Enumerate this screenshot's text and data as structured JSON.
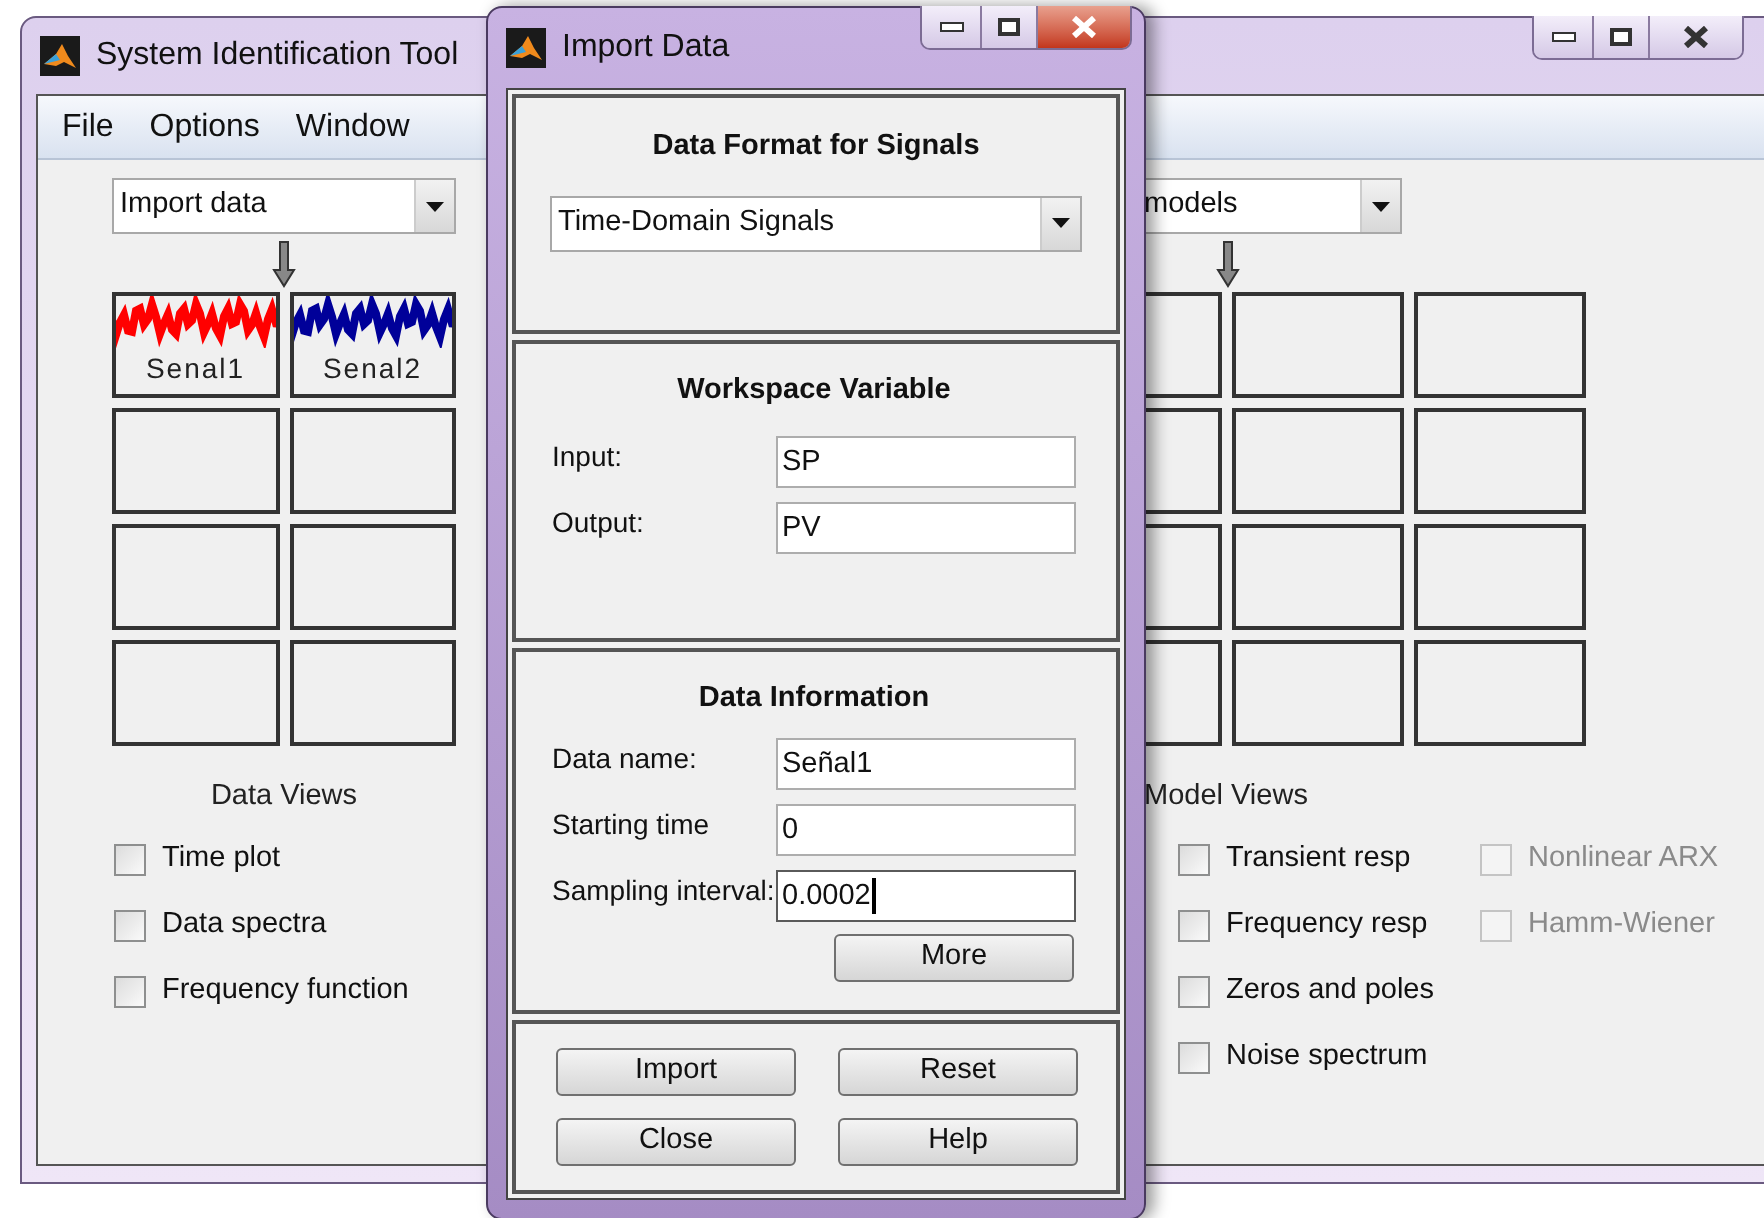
{
  "main_window": {
    "title": "System Identification Tool",
    "menu": [
      "File",
      "Options",
      "Window"
    ],
    "data_dropdown": {
      "value": "Import data"
    },
    "data_slots": [
      {
        "label": "Senal1",
        "color": "#ff0000"
      },
      {
        "label": "Senal2",
        "color": "#000099"
      }
    ],
    "data_views_label": "Data Views",
    "data_views": [
      {
        "label": "Time plot",
        "checked": false
      },
      {
        "label": "Data spectra",
        "checked": false
      },
      {
        "label": "Frequency function",
        "checked": false
      }
    ],
    "model_dropdown": {
      "value": "models"
    },
    "model_views_label": "Model Views",
    "model_view_columns": [
      {
        "items": [
          {
            "label": "Transient resp",
            "checked": false,
            "disabled": false
          },
          {
            "label": "Frequency resp",
            "checked": false,
            "disabled": false
          },
          {
            "label": "Zeros and poles",
            "checked": false,
            "disabled": false
          },
          {
            "label": "Noise spectrum",
            "checked": false,
            "disabled": false
          }
        ]
      },
      {
        "items": [
          {
            "label": "Nonlinear ARX",
            "checked": false,
            "disabled": true
          },
          {
            "label": "Hamm-Wiener",
            "checked": false,
            "disabled": true
          }
        ]
      }
    ]
  },
  "dialog": {
    "title": "Import Data",
    "format_section": {
      "heading": "Data Format for Signals",
      "dropdown": {
        "value": "Time-Domain Signals"
      }
    },
    "workspace_section": {
      "heading": "Workspace Variable",
      "fields": [
        {
          "label": "Input:",
          "value": "SP",
          "focused": false
        },
        {
          "label": "Output:",
          "value": "PV",
          "focused": false
        }
      ]
    },
    "info_section": {
      "heading": "Data Information",
      "fields": [
        {
          "label": "Data name:",
          "value": "Señal1",
          "focused": false
        },
        {
          "label": "Starting time",
          "value": "0",
          "focused": false
        },
        {
          "label": "Sampling interval:",
          "value": "0.0002",
          "focused": true
        }
      ],
      "more_button": "More"
    },
    "buttons": [
      "Import",
      "Reset",
      "Close",
      "Help"
    ]
  }
}
